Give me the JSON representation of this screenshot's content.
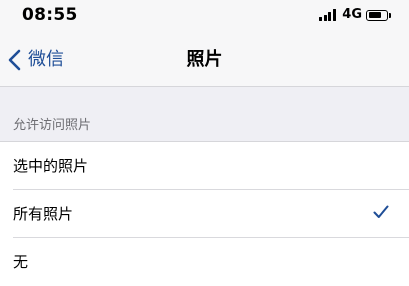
{
  "status_bar": {
    "time": "08:55",
    "network": "4G",
    "battery_level": 0.75
  },
  "nav": {
    "back_label": "微信",
    "title": "照片"
  },
  "section": {
    "header": "允许访问照片"
  },
  "options": [
    {
      "label": "选中的照片",
      "selected": false
    },
    {
      "label": "所有照片",
      "selected": true
    },
    {
      "label": "无",
      "selected": false
    }
  ],
  "colors": {
    "accent": "#1f4e97",
    "group_background": "#efeff4",
    "nav_background": "#f7f7f8",
    "secondary_text": "#6d6d72"
  }
}
